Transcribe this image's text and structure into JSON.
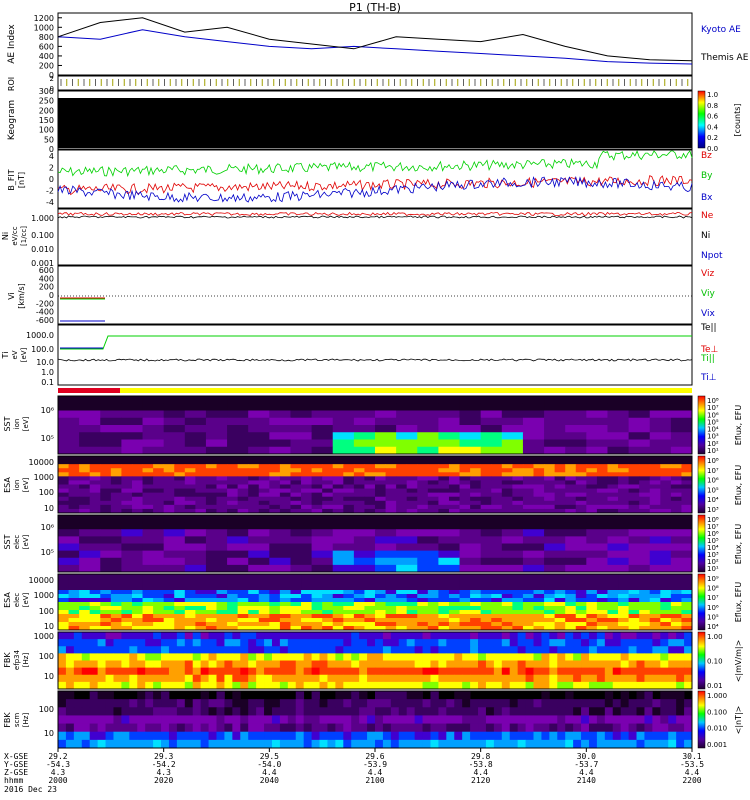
{
  "title": "P1 (TH-B)",
  "colors": {
    "black": "#000000",
    "blue": "#0000c8",
    "red": "#e00000",
    "green": "#00d000",
    "yellow": "#ffff00",
    "spec_bg": "#000000"
  },
  "panels": {
    "ae": {
      "ylabel": "AE Index",
      "ticks": [
        "1200",
        "1000",
        "800",
        "600",
        "400",
        "200",
        "0"
      ],
      "tick_values": [
        1200,
        1000,
        800,
        600,
        400,
        200,
        0
      ],
      "ylim": [
        0,
        1300
      ],
      "legend": [
        "Kyoto AE",
        "Themis AE"
      ]
    },
    "roi": {
      "ylabel": "ROI",
      "ticks": [
        "2",
        "0"
      ]
    },
    "keogram": {
      "ylabel": "Keogram",
      "ticks": [
        "300",
        "250",
        "200",
        "150",
        "100",
        "50",
        "0"
      ],
      "tick_values": [
        300,
        250,
        200,
        150,
        100,
        50,
        0
      ],
      "ylim": [
        0,
        300
      ],
      "cbar_label": "[counts]",
      "cbar_ticks": [
        "1.0",
        "0.8",
        "0.6",
        "0.4",
        "0.2",
        "0.0"
      ]
    },
    "bfield": {
      "ylabel": [
        "B_FIT",
        "[nT]"
      ],
      "ticks": [
        "4",
        "2",
        "0",
        "-2",
        "-4"
      ],
      "tick_values": [
        4,
        2,
        0,
        -2,
        -4
      ],
      "ylim": [
        -5,
        5
      ],
      "legend": [
        "Bz",
        "By",
        "Bx"
      ]
    },
    "density": {
      "ylabel": [
        "Ni",
        "eV/cc",
        "[1/cc]"
      ],
      "ticks": [
        "1.000",
        "0.100",
        "0.010",
        "0.001"
      ],
      "legend": [
        "Ne",
        "Ni",
        "Npot"
      ]
    },
    "velocity": {
      "ylabel": [
        "Vi",
        "[km/s]"
      ],
      "ticks": [
        "600",
        "400",
        "200",
        "0",
        "-200",
        "-400",
        "-600"
      ],
      "tick_values": [
        600,
        400,
        200,
        0,
        -200,
        -400,
        -600
      ],
      "ylim": [
        -700,
        700
      ],
      "legend": [
        "Viz",
        "Viy",
        "Vix"
      ]
    },
    "temperature": {
      "ylabel": [
        "Ti",
        "eV",
        "[eV]"
      ],
      "ticks": [
        "1000.0",
        "100.0",
        "10.0",
        "1.0",
        "0.1"
      ],
      "legend": [
        "Te||",
        "Te⊥",
        "Ti||",
        "Ti⊥"
      ]
    },
    "sst_ion": {
      "ylabel": [
        "SST",
        "ion",
        "[eV]"
      ],
      "ticks": [
        "10⁶",
        "10⁵"
      ],
      "cbar_label": "Eflux, EFU",
      "cbar_ticks": [
        "10⁸",
        "10⁷",
        "10⁶",
        "10⁵",
        "10⁴",
        "10³",
        "10²",
        "10¹"
      ]
    },
    "esa_ion": {
      "ylabel": [
        "ESA",
        "ion",
        "[eV]"
      ],
      "ticks": [
        "10000",
        "1000",
        "100",
        "10"
      ],
      "cbar_label": "Eflux, EFU",
      "cbar_ticks": [
        "10⁸",
        "10⁷",
        "10⁶",
        "10⁵",
        "10⁴",
        "10³"
      ]
    },
    "sst_elec": {
      "ylabel": [
        "SST",
        "elec",
        "[eV]"
      ],
      "ticks": [
        "10⁶",
        "10⁵"
      ],
      "cbar_label": "Eflux, EFU",
      "cbar_ticks": [
        "10⁸",
        "10⁷",
        "10⁶",
        "10⁵",
        "10⁴",
        "10³",
        "10²",
        "10¹"
      ]
    },
    "esa_elec": {
      "ylabel": [
        "ESA",
        "elec",
        "[eV]"
      ],
      "ticks": [
        "10000",
        "1000",
        "100",
        "10"
      ],
      "cbar_label": "Eflux, EFU",
      "cbar_ticks": [
        "10⁹",
        "10⁸",
        "10⁷",
        "10⁶",
        "10⁵",
        "10⁴"
      ]
    },
    "fbk_e": {
      "ylabel": [
        "FBK",
        "efp34",
        "[Hz]"
      ],
      "ticks": [
        "1000",
        "100",
        "10"
      ],
      "cbar_label": "<|mV/m|>",
      "cbar_ticks": [
        "1.00",
        "0.10",
        "0.01"
      ]
    },
    "fbk_b": {
      "ylabel": [
        "FBK",
        "scm",
        "[Hz]"
      ],
      "ticks": [
        "100",
        "10"
      ],
      "cbar_label": "<|nT|>",
      "cbar_ticks": [
        "1.000",
        "0.100",
        "0.010",
        "0.001"
      ]
    }
  },
  "xaxis": {
    "row_labels": [
      "X-GSE",
      "Y-GSE",
      "Z-GSE",
      "hhmm",
      "2016 Dec 23"
    ],
    "columns": [
      {
        "x": "29.2",
        "y": "-54.3",
        "z": "4.3",
        "t": "2000"
      },
      {
        "x": "29.3",
        "y": "-54.2",
        "z": "4.3",
        "t": "2020"
      },
      {
        "x": "29.5",
        "y": "-54.0",
        "z": "4.4",
        "t": "2040"
      },
      {
        "x": "29.6",
        "y": "-53.9",
        "z": "4.4",
        "t": "2100"
      },
      {
        "x": "29.8",
        "y": "-53.8",
        "z": "4.4",
        "t": "2120"
      },
      {
        "x": "30.0",
        "y": "-53.7",
        "z": "4.4",
        "t": "2140"
      },
      {
        "x": "30.1",
        "y": "-53.5",
        "z": "4.4",
        "t": "2200"
      }
    ]
  },
  "chart_data": {
    "type": "line",
    "title": "P1 (TH-B)",
    "x": [
      "2000",
      "2020",
      "2040",
      "2100",
      "2120",
      "2140",
      "2200"
    ],
    "xlabel": "hhmm",
    "series": [
      {
        "name": "Kyoto AE",
        "values": [
          800,
          750,
          950,
          800,
          700,
          600,
          550,
          600,
          550,
          500,
          450,
          400,
          350,
          280,
          250,
          230
        ]
      },
      {
        "name": "Themis AE",
        "values": [
          800,
          1100,
          1200,
          900,
          1000,
          750,
          650,
          550,
          800,
          750,
          700,
          850,
          600,
          400,
          320,
          300
        ]
      }
    ],
    "ylim": [
      0,
      1300
    ]
  }
}
